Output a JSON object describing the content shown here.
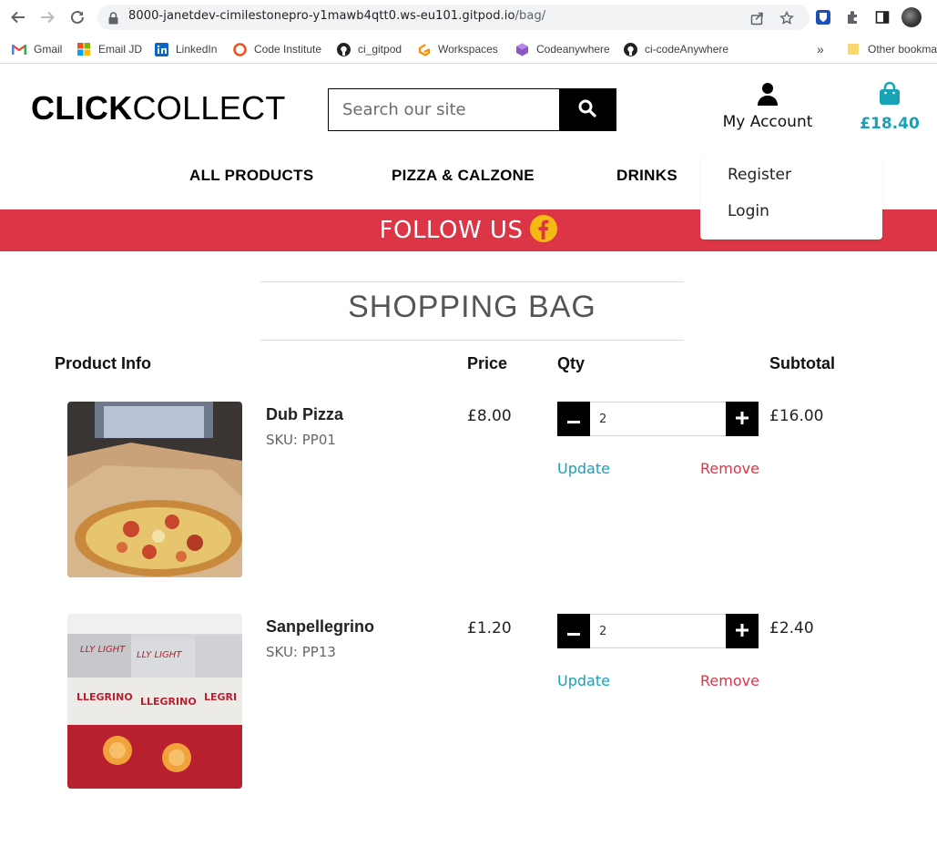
{
  "browser": {
    "url_host": "8000-janetdev-cimilestonepro-y1mawb4qtt0.ws-eu101.gitpod.io",
    "url_path": "/bag/",
    "bookmarks": [
      {
        "label": "Gmail",
        "icon": "gmail-icon"
      },
      {
        "label": "Email JD",
        "icon": "microsoft-icon"
      },
      {
        "label": "LinkedIn",
        "icon": "linkedin-icon"
      },
      {
        "label": "Code Institute",
        "icon": "code-institute-icon"
      },
      {
        "label": "ci_gitpod",
        "icon": "github-icon"
      },
      {
        "label": "Workspaces",
        "icon": "gitpod-icon"
      },
      {
        "label": "Codeanywhere",
        "icon": "codeanywhere-icon"
      },
      {
        "label": "ci-codeAnywhere",
        "icon": "github-icon"
      }
    ],
    "overflow": "»",
    "other_bookmarks": "Other bookma"
  },
  "header": {
    "logo_bold": "CLICK",
    "logo_light": "COLLECT",
    "search_placeholder": "Search our site",
    "account_label": "My Account",
    "bag_total": "£18.40"
  },
  "nav": [
    "ALL PRODUCTS",
    "PIZZA & CALZONE",
    "DRINKS"
  ],
  "account_menu": [
    "Register",
    "Login"
  ],
  "banner": {
    "text": "FOLLOW US",
    "icon": "facebook-icon"
  },
  "colors": {
    "accent": "#17a2b8",
    "danger": "#dc3545",
    "banner": "#dc3545"
  },
  "bag": {
    "title": "SHOPPING BAG",
    "columns": [
      "Product Info",
      "Price",
      "Qty",
      "Subtotal"
    ],
    "items": [
      {
        "name": "Dub Pizza",
        "sku": "SKU: PP01",
        "price": "£8.00",
        "qty": "2",
        "subtotal": "£16.00",
        "update": "Update",
        "remove": "Remove"
      },
      {
        "name": "Sanpellegrino",
        "sku": "SKU: PP13",
        "price": "£1.20",
        "qty": "2",
        "subtotal": "£2.40",
        "update": "Update",
        "remove": "Remove"
      }
    ]
  }
}
